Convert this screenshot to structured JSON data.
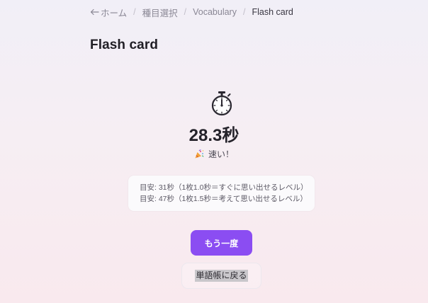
{
  "breadcrumb": {
    "home": "ホーム",
    "category": "種目選択",
    "section": "Vocabulary",
    "current": "Flash card",
    "separator": "/"
  },
  "page": {
    "title": "Flash card"
  },
  "result": {
    "icon": "stopwatch-icon",
    "time": "28.3秒",
    "speed_icon": "party-popper-icon",
    "speed_label": "速い！"
  },
  "guide": {
    "lines": [
      "目安: 31秒（1枚1.0秒＝すぐに思い出せるレベル）",
      "目安: 47秒（1枚1.5秒＝考えて思い出せるレベル）"
    ]
  },
  "actions": {
    "retry_label": "もう一度",
    "back_label": "単語帳に戻る"
  },
  "colors": {
    "accent": "#8b4df2"
  }
}
